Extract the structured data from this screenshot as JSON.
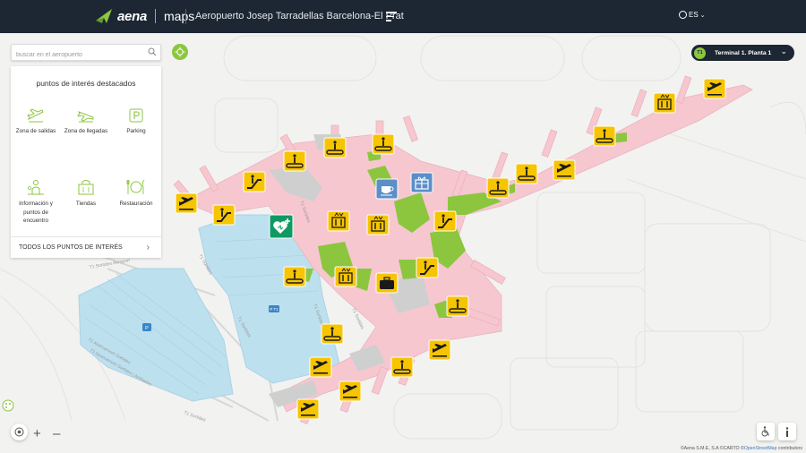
{
  "header": {
    "brand": "aena",
    "product": "maps",
    "airport_name": "Aeropuerto Josep Tarradellas Barcelona-El Prat",
    "language": "ES"
  },
  "search": {
    "placeholder": "buscar en el aeropuerto"
  },
  "poi_panel": {
    "title": "puntos de interés destacados",
    "items": [
      {
        "label": "Zona de salidas",
        "icon": "departures-icon"
      },
      {
        "label": "Zona de llegadas",
        "icon": "arrivals-icon"
      },
      {
        "label": "Parking",
        "icon": "parking-icon"
      },
      {
        "label": "Información y puntos de encuentro",
        "icon": "information-icon"
      },
      {
        "label": "Tiendas",
        "icon": "shops-icon"
      },
      {
        "label": "Restauración",
        "icon": "restaurant-icon"
      }
    ],
    "all_link": "TODOS LOS PUNTOS DE INTERÉS"
  },
  "terminal_selector": {
    "badge": "T1",
    "label": "Terminal 1. Planta 1"
  },
  "map": {
    "road_labels": [
      "T1 Sortides Aeroport",
      "T1 Sortides",
      "T1 Sortides",
      "T1 Sortides",
      "T1 Aparcament Sortides",
      "T1 Aparcament Sortides | Arribades",
      "T1 Sortides",
      "T1 Sortides",
      "T1 Sortides"
    ],
    "small_badges": [
      "P",
      "P T1"
    ],
    "markers": [
      "departures-gate-icon",
      "escalator-icon",
      "escalator-icon",
      "walkway-icon",
      "walkway-icon",
      "walkway-icon",
      "coffee-icon",
      "gift-shop-icon",
      "elevator-icon",
      "elevator-icon",
      "escalator-icon",
      "walkway-icon",
      "walkway-icon",
      "departures-gate-icon",
      "walkway-icon",
      "elevator-icon",
      "walkway-icon",
      "elevator-icon",
      "departures-gate-icon",
      "walkway-icon",
      "escalator-icon",
      "baggage-icon",
      "walkway-icon",
      "walkway-icon",
      "departures-gate-icon",
      "departures-gate-icon",
      "departures-gate-icon",
      "departures-gate-icon",
      "first-aid-icon"
    ]
  },
  "attribution": {
    "text": "©Aena S.M.E, S.A ©CARTO ©",
    "osm": "OpenStreetMap",
    "suffix": " contributors"
  },
  "colors": {
    "header_bg": "#1c2733",
    "accent_green": "#8cc63f",
    "terminal_pink": "#f6c7cf",
    "marker_yellow": "#f7c400",
    "marker_blue": "#5a8fc8",
    "parking_blue": "#bde0ef"
  }
}
